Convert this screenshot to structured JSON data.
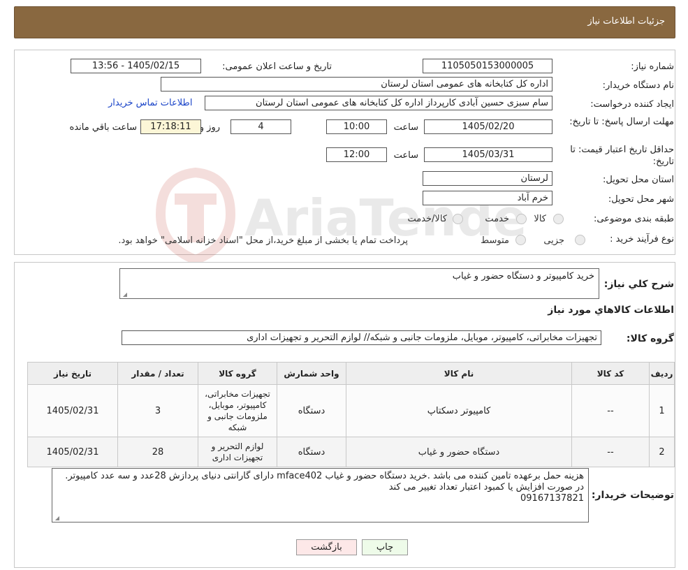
{
  "header": {
    "title": "جزئیات اطلاعات نیاز"
  },
  "watermark": {
    "text": "AriaTender.neT"
  },
  "form": {
    "need_number_label": "شماره نیاز:",
    "need_number": "1105050153000005",
    "announce_label": "تاریخ و ساعت اعلان عمومی:",
    "announce_value": "1405/02/15 - 13:56",
    "buyer_org_label": "نام دستگاه خریدار:",
    "buyer_org": "اداره کل کتابخانه های عمومی استان لرستان",
    "requester_label": "ایجاد کننده درخواست:",
    "requester": "سام سبزی حسین آبادی کارپرداز اداره کل کتابخانه های عمومی استان لرستان",
    "contact_link": "اطلاعات تماس خریدار",
    "deadline_label": "مهلت ارسال پاسخ: تا تاریخ:",
    "deadline_date": "1405/02/20",
    "time_label": "ساعت",
    "deadline_time": "10:00",
    "days_value": "4",
    "days_label": "روز و",
    "remaining_time": "17:18:11",
    "remaining_label": "ساعت باقي مانده",
    "validity_label": "حداقل تاریخ اعتبار قیمت: تا تاریخ:",
    "validity_date": "1405/03/31",
    "validity_time": "12:00",
    "province_label": "استان محل تحویل:",
    "province": "لرستان",
    "city_label": "شهر محل تحویل:",
    "city": "خرم آباد",
    "category_label": "طبقه بندی موضوعی:",
    "category_options": [
      "کالا",
      "خدمت",
      "کالا/خدمت"
    ],
    "process_label": "نوع فرآیند خرید :",
    "process_options": [
      "جزیی",
      "متوسط"
    ],
    "process_note": "پرداخت تمام یا بخشی از مبلغ خرید،از محل \"اسناد خزانه اسلامی\" خواهد بود."
  },
  "details": {
    "summary_label": "شرح کلي نياز:",
    "summary": "خرید کامپیوتر و دستگاه حضور و غیاب",
    "items_title": "اطلاعات کالاهاي مورد نياز",
    "group_label": "گروه کالا:",
    "group": "تجهیزات مخابراتی، کامپیوتر، موبایل، ملزومات جانبی و شبکه// لوازم التحریر و تجهیزات اداری",
    "columns": [
      "رديف",
      "کد کالا",
      "نام کالا",
      "واحد شمارش",
      "گروه کالا",
      "تعداد / مقدار",
      "تاریخ نیاز"
    ],
    "rows": [
      {
        "row": "1",
        "code": "--",
        "name": "کامپیوتر دسکتاپ",
        "unit": "دستگاه",
        "group": "تجهیزات مخابراتی، کامپیوتر، موبایل، ملزومات جانبی و شبکه",
        "qty": "3",
        "date": "1405/02/31"
      },
      {
        "row": "2",
        "code": "--",
        "name": "دستگاه حضور و غیاب",
        "unit": "دستگاه",
        "group": "لوازم التحریر و تجهیزات اداری",
        "qty": "28",
        "date": "1405/02/31"
      }
    ],
    "buyer_notes_label": "توضیحات خریدار:",
    "buyer_notes": "هزینه حمل برعهده تامین کننده می باشد .خرید دستگاه حضور و غیاب mface402 دارای گارانتی دنیای پردازش 28عدد و سه عدد کامپیوتر. در صورت افزایش یا کمبود اعتبار تعداد تغییر می کند",
    "buyer_phone": "09167137821"
  },
  "buttons": {
    "print": "چاپ",
    "back": "بازگشت"
  }
}
